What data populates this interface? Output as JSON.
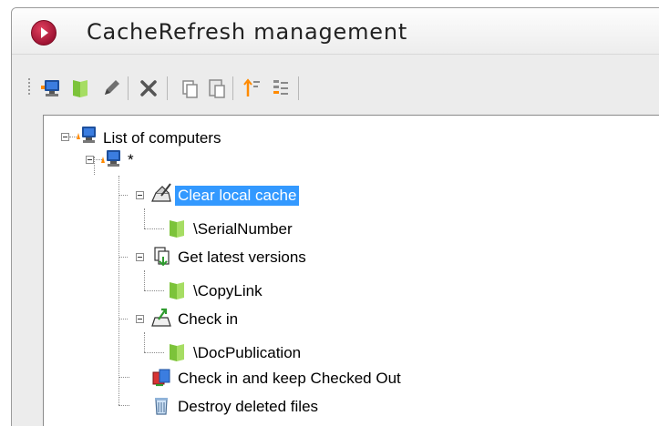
{
  "window": {
    "title": "CacheRefresh management"
  },
  "toolbar": {
    "buttons": [
      {
        "icon": "computer-icon",
        "label": ""
      },
      {
        "icon": "folder-icon",
        "label": ""
      },
      {
        "icon": "pencil-icon",
        "label": ""
      },
      {
        "icon": "delete-x-icon",
        "label": ""
      },
      {
        "icon": "copy-icon",
        "label": ""
      },
      {
        "icon": "paste-icon",
        "label": ""
      },
      {
        "icon": "move-up-icon",
        "label": ""
      },
      {
        "icon": "sort-icon",
        "label": ""
      }
    ]
  },
  "tree": {
    "root": {
      "label": "List of computers",
      "icon": "computer-network-icon"
    },
    "computer": {
      "label": "*",
      "icon": "computer-network-icon"
    },
    "tasks": [
      {
        "label": "Clear local cache",
        "icon": "broom-cache-icon",
        "selected": true,
        "child": {
          "label": "\\SerialNumber",
          "icon": "folder-icon"
        }
      },
      {
        "label": "Get latest versions",
        "icon": "document-download-icon",
        "selected": false,
        "child": {
          "label": "\\CopyLink",
          "icon": "folder-icon"
        }
      },
      {
        "label": "Check in",
        "icon": "check-in-icon",
        "selected": false,
        "child": {
          "label": "\\DocPublication",
          "icon": "folder-icon"
        }
      },
      {
        "label": "Check in and keep Checked Out",
        "icon": "check-in-keep-icon",
        "selected": false,
        "child": null
      },
      {
        "label": "Destroy deleted files",
        "icon": "recycle-bin-icon",
        "selected": false,
        "child": null
      }
    ]
  },
  "colors": {
    "selection": "#3399ff",
    "folder_green": "#8fd14f",
    "title_icon": "#c41e3a"
  }
}
